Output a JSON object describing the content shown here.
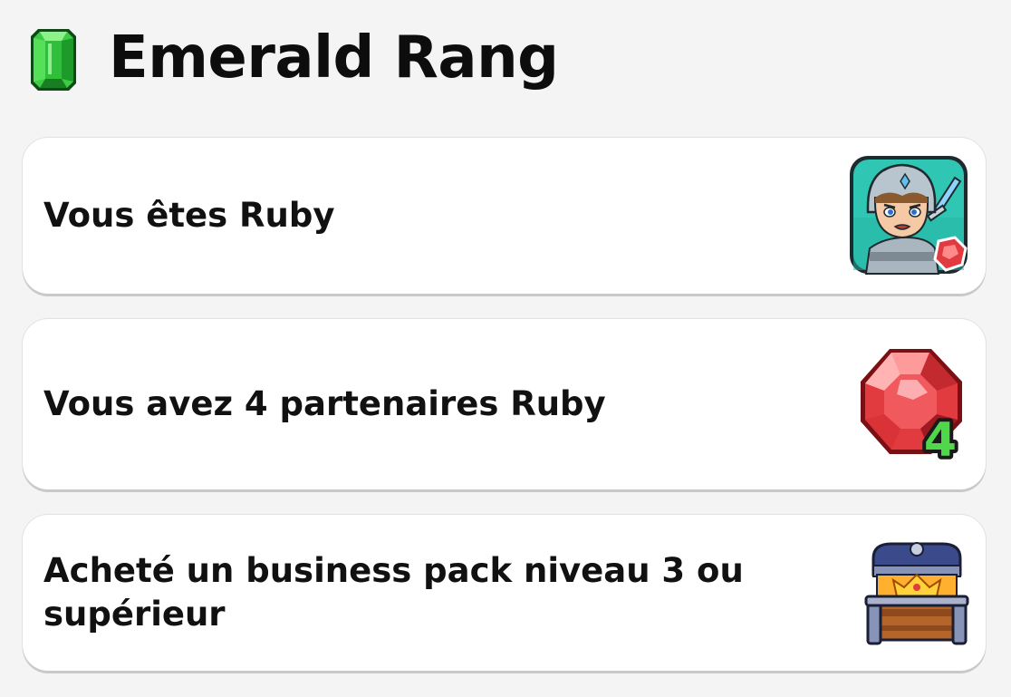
{
  "header": {
    "title": "Emerald Rang",
    "icon": "emerald-gem-icon"
  },
  "requirements": [
    {
      "text": "Vous êtes Ruby",
      "icon": "ruby-knight-icon"
    },
    {
      "text": "Vous avez 4 partenaires Ruby",
      "icon": "ruby-gem-4-icon"
    },
    {
      "text": "Acheté un business pack niveau 3 ou supérieur",
      "icon": "treasure-chest-crown-icon"
    }
  ],
  "colors": {
    "background": "#f4f4f4",
    "card": "#ffffff",
    "emerald": "#2fbf3a",
    "ruby": "#e23b3f",
    "teal": "#2fc6b4"
  }
}
